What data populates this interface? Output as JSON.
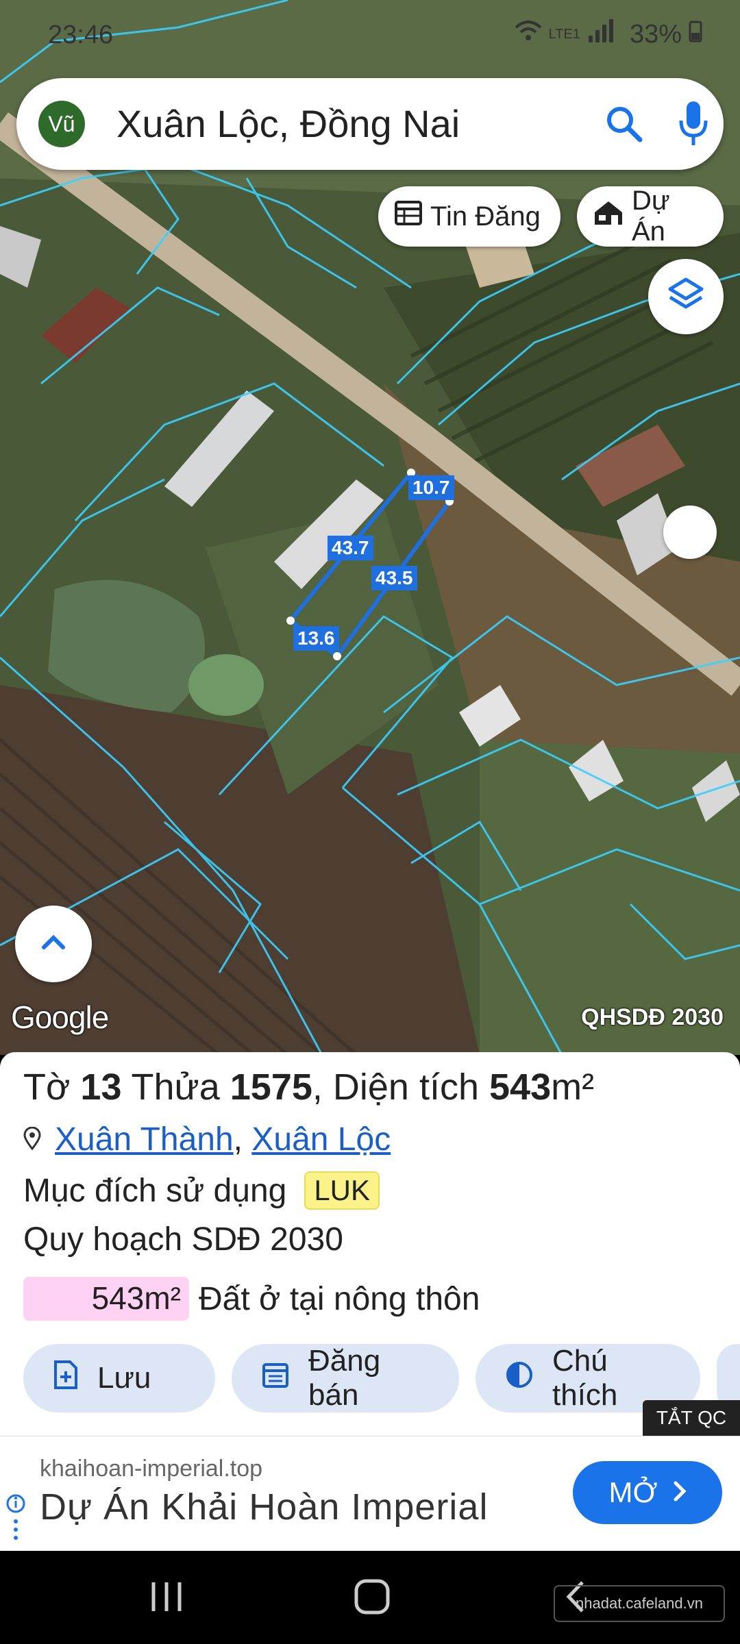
{
  "status_bar": {
    "time": "23:46",
    "battery": "33%",
    "network": "LTE1"
  },
  "search": {
    "avatar_text": "Vũ",
    "query": "Xuân Lộc, Đồng Nai"
  },
  "chips": {
    "listing": "Tin Đăng",
    "project": "Dự Án"
  },
  "map": {
    "google_label": "Google",
    "plan_tag": "QHSDĐ 2030",
    "dimensions": {
      "top": "10.7",
      "left": "43.7",
      "right": "43.5",
      "bottom": "13.6"
    },
    "colors": {
      "parcel_lines": "#3ad0ff",
      "selected_parcel": "#1e6fe0"
    }
  },
  "parcel": {
    "sheet_label": "Tờ",
    "sheet": "13",
    "lot_label": "Thửa",
    "lot": "1575",
    "area_label": ", Diện tích",
    "area": "543",
    "area_unit": "m²",
    "ward": "Xuân Thành",
    "district": "Xuân Lộc",
    "separator": ",",
    "use_label": "Mục đích sử dụng",
    "use_code": "LUK",
    "plan_label": "Quy hoạch SDĐ 2030",
    "zone_area": "543m²",
    "zone_type": "Đất ở tại nông thôn",
    "zone_color": "#ffd2f4"
  },
  "actions": {
    "save": "Lưu",
    "post": "Đăng bán",
    "legend": "Chú thích"
  },
  "ad": {
    "close_label": "TẮT QC",
    "domain": "khaihoan-imperial.top",
    "headline": "Dự Án Khải Hoàn Imperial",
    "open_label": "MỞ",
    "accent": "#1a73e8"
  },
  "watermark": "nhadat.cafeland.vn"
}
